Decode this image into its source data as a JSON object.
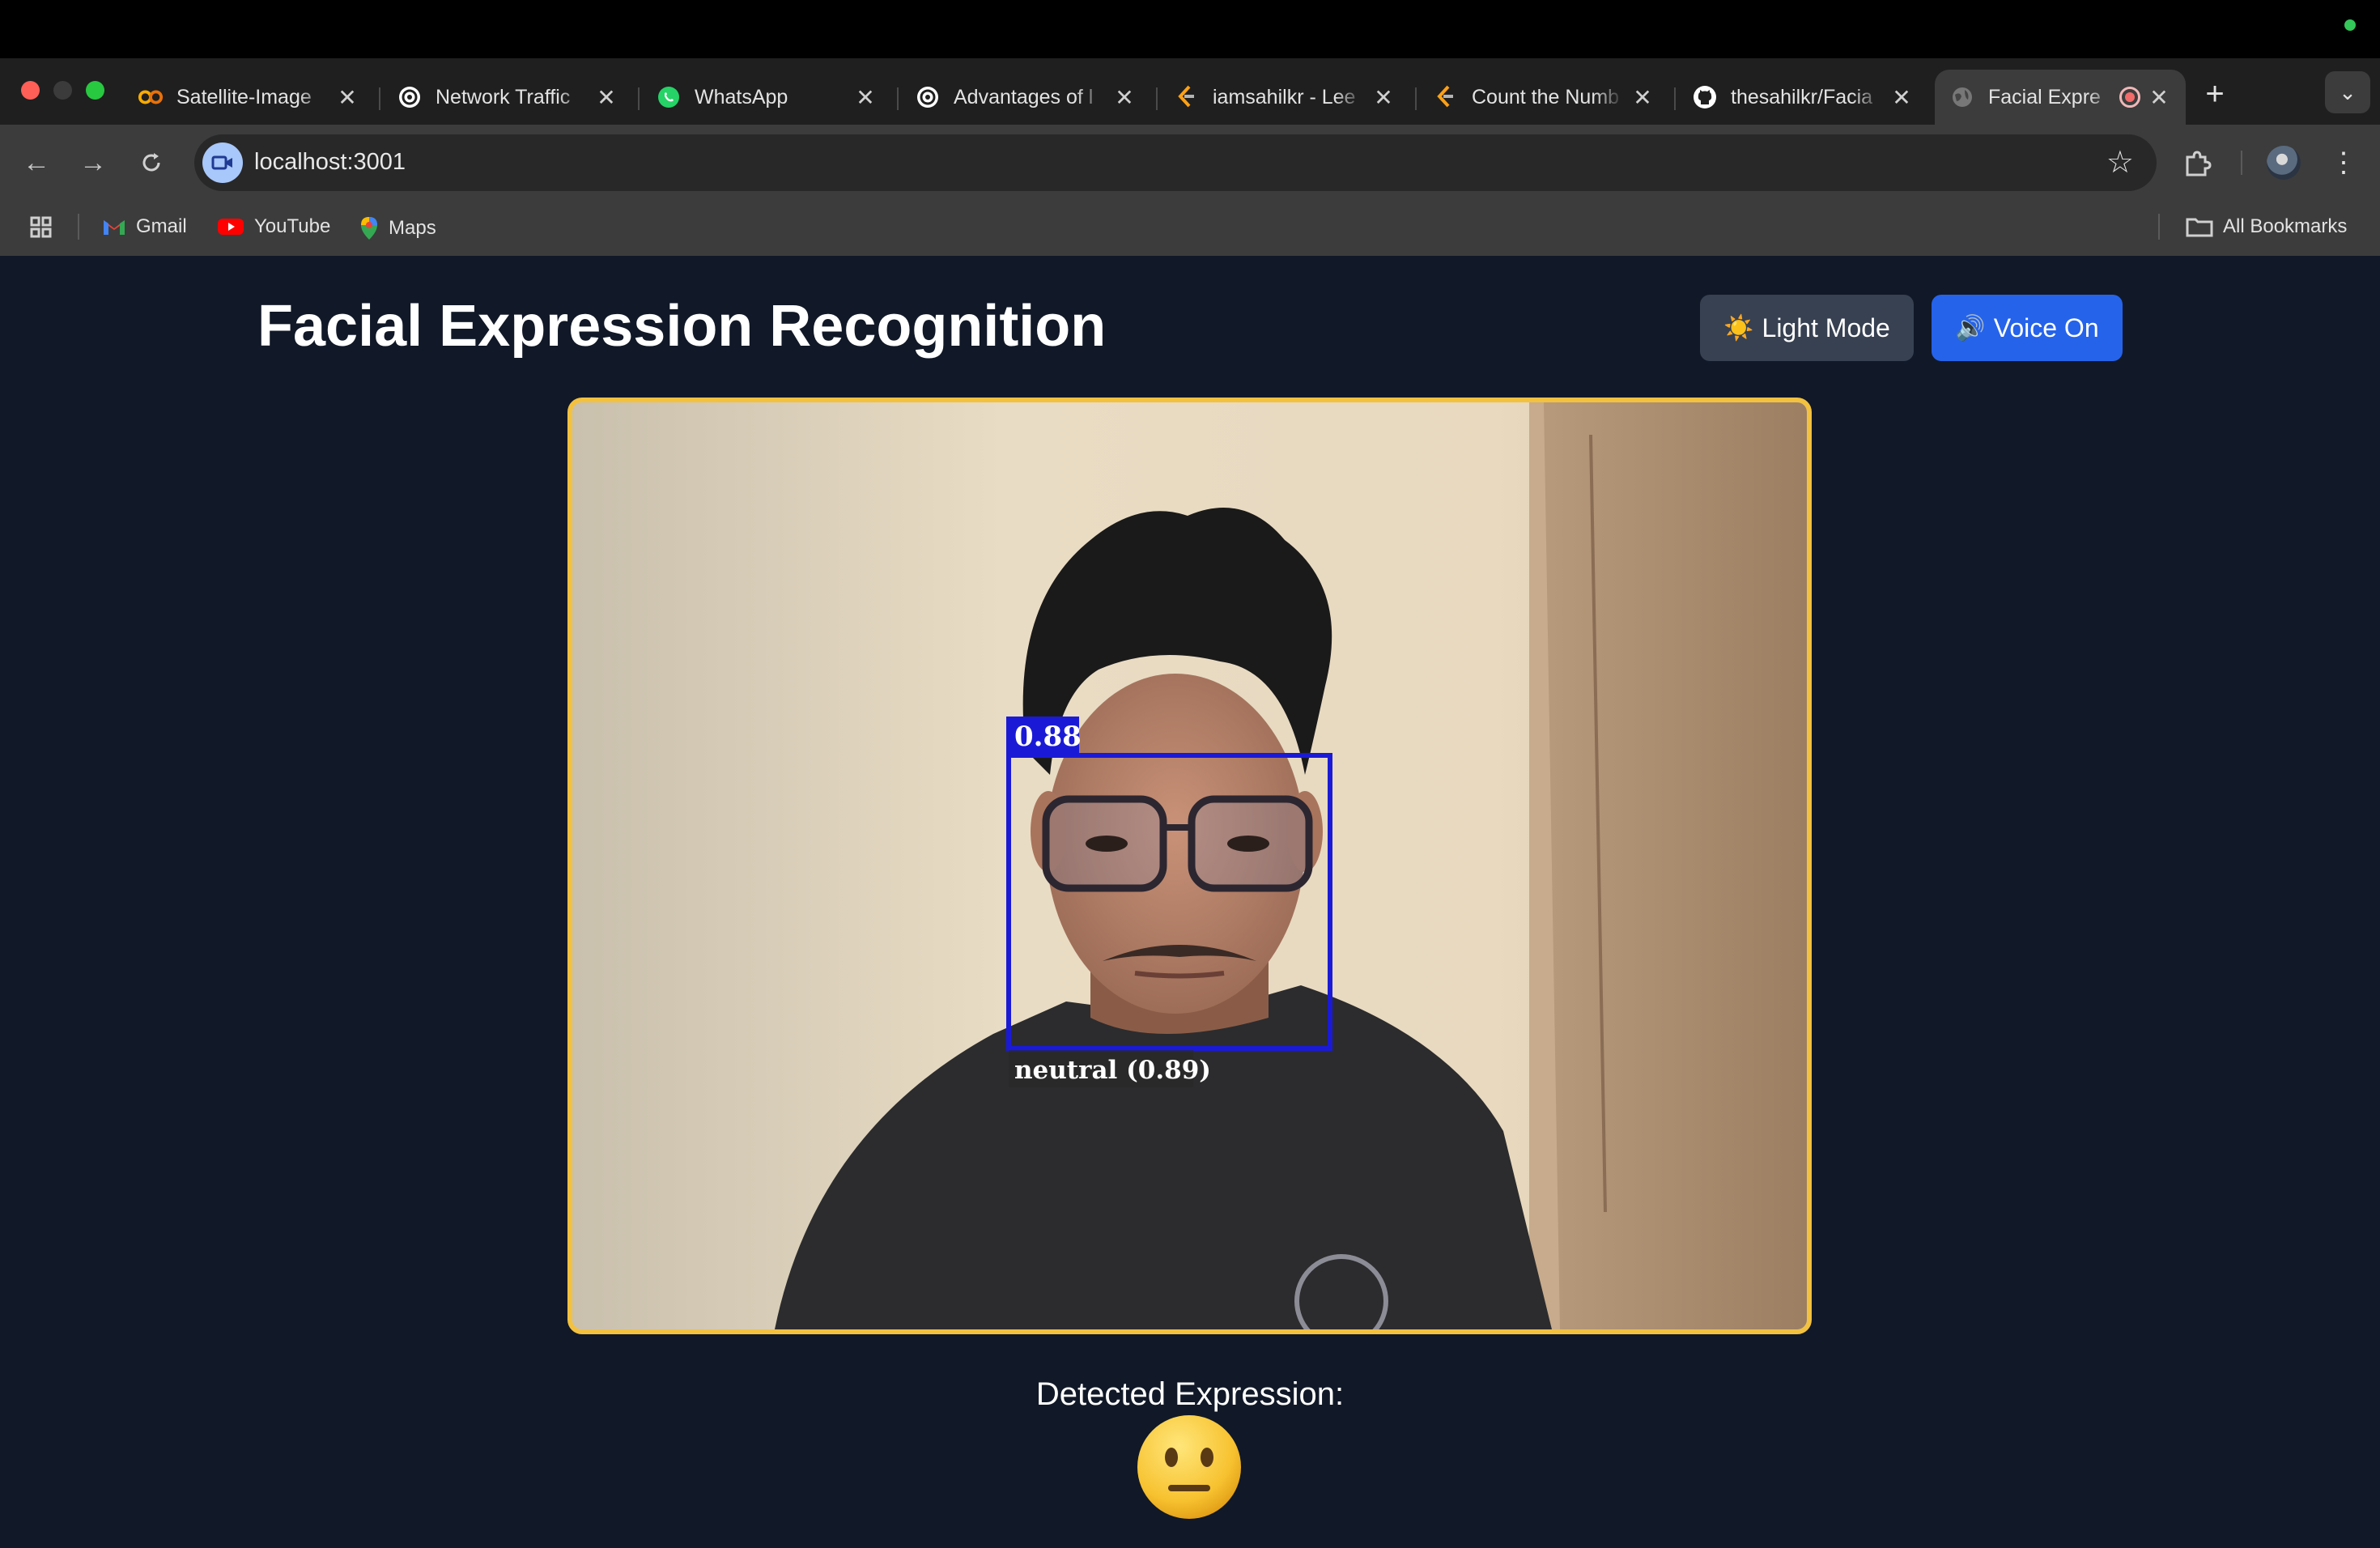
{
  "browser": {
    "tabs": [
      {
        "title": "Satellite-Image",
        "icon": "colab-icon"
      },
      {
        "title": "Network Traffic",
        "icon": "openai-icon"
      },
      {
        "title": "WhatsApp",
        "icon": "whatsapp-icon"
      },
      {
        "title": "Advantages of l",
        "icon": "openai-icon"
      },
      {
        "title": "iamsahilkr - Lee",
        "icon": "leetcode-icon"
      },
      {
        "title": "Count the Numb",
        "icon": "leetcode-icon"
      },
      {
        "title": "thesahilkr/Facia",
        "icon": "github-icon"
      },
      {
        "title": "Facial Expre",
        "icon": "globe-icon",
        "active": true,
        "recording": true
      }
    ],
    "url": "localhost:3001",
    "bookmarks": [
      {
        "label": "Gmail",
        "icon": "gmail-icon"
      },
      {
        "label": "YouTube",
        "icon": "youtube-icon"
      },
      {
        "label": "Maps",
        "icon": "maps-icon"
      }
    ],
    "all_bookmarks_label": "All Bookmarks"
  },
  "app": {
    "title": "Facial Expression Recognition",
    "light_mode_label": "Light Mode",
    "voice_label": "Voice On",
    "light_mode_icon": "☀️",
    "voice_icon": "🔊",
    "detection": {
      "score_label": "0.88",
      "expression_label": "neutral (0.89)",
      "box_color": "#1a1ad6"
    },
    "detected_label": "Detected Expression:",
    "detected_emoji": "neutral-face",
    "frame_color": "#f3c140",
    "accent": "#2563eb"
  }
}
